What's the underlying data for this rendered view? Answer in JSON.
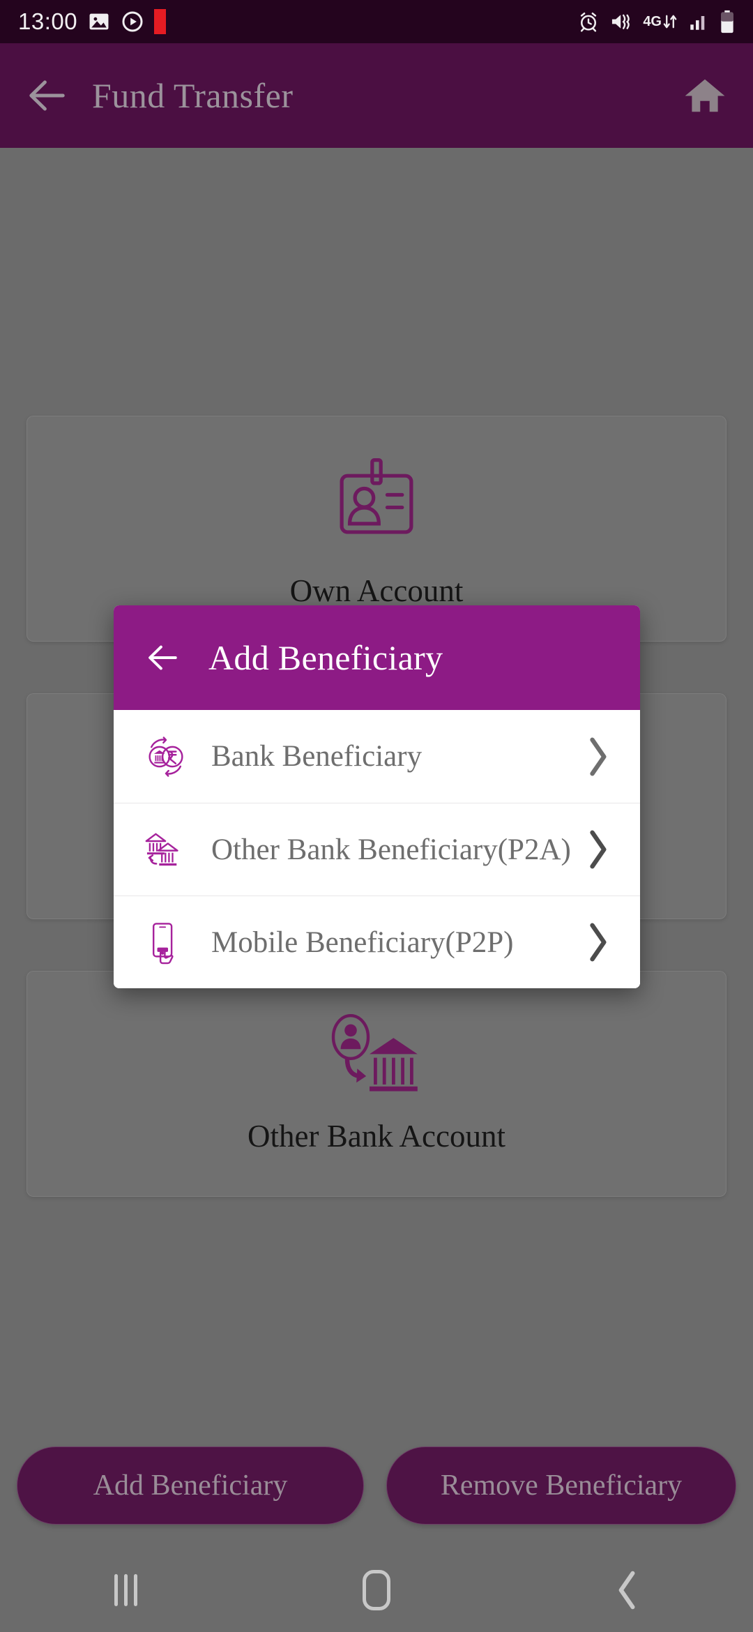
{
  "status_bar": {
    "time": "13:00",
    "left_icons": [
      "image-icon",
      "record-circle-icon",
      "red-flag-icon"
    ],
    "right_icons": [
      "alarm-icon",
      "mute-vibrate-icon",
      "4g-data-icon",
      "signal-bars-icon",
      "battery-icon"
    ],
    "network_label": "4G",
    "background_color": "#24041e"
  },
  "toolbar": {
    "back_icon": "arrow-left-icon",
    "title": "Fund Transfer",
    "home_icon": "home-icon",
    "background_color": "#4b0f42",
    "text_color": "#9c939c"
  },
  "main": {
    "cards": [
      {
        "label": "Own Account",
        "icon": "id-card-person-icon"
      },
      {
        "label": "",
        "icon": ""
      },
      {
        "label": "Other Bank Account",
        "icon": "person-to-bank-transfer-icon"
      }
    ]
  },
  "action_bar": {
    "add_label": "Add Beneficiary",
    "remove_label": "Remove Beneficiary",
    "button_color": "#4e1345"
  },
  "dialog": {
    "back_icon": "arrow-left-icon",
    "title": "Add Beneficiary",
    "header_color": "#8d1b85",
    "accent_color": "#a6229c",
    "items": [
      {
        "label": "Bank Beneficiary",
        "icon": "bank-rupee-exchange-icon",
        "chevron": "chevron-right-icon"
      },
      {
        "label": "Other Bank Beneficiary(P2A)",
        "icon": "bank-to-bank-transfer-icon",
        "chevron": "chevron-right-icon"
      },
      {
        "label": "Mobile Beneficiary(P2P)",
        "icon": "mobile-tap-icon",
        "chevron": "chevron-right-icon"
      }
    ]
  },
  "nav_bar": {
    "recents_label": "recents-icon",
    "home_label": "home-square-icon",
    "back_label": "back-chevron-icon"
  }
}
